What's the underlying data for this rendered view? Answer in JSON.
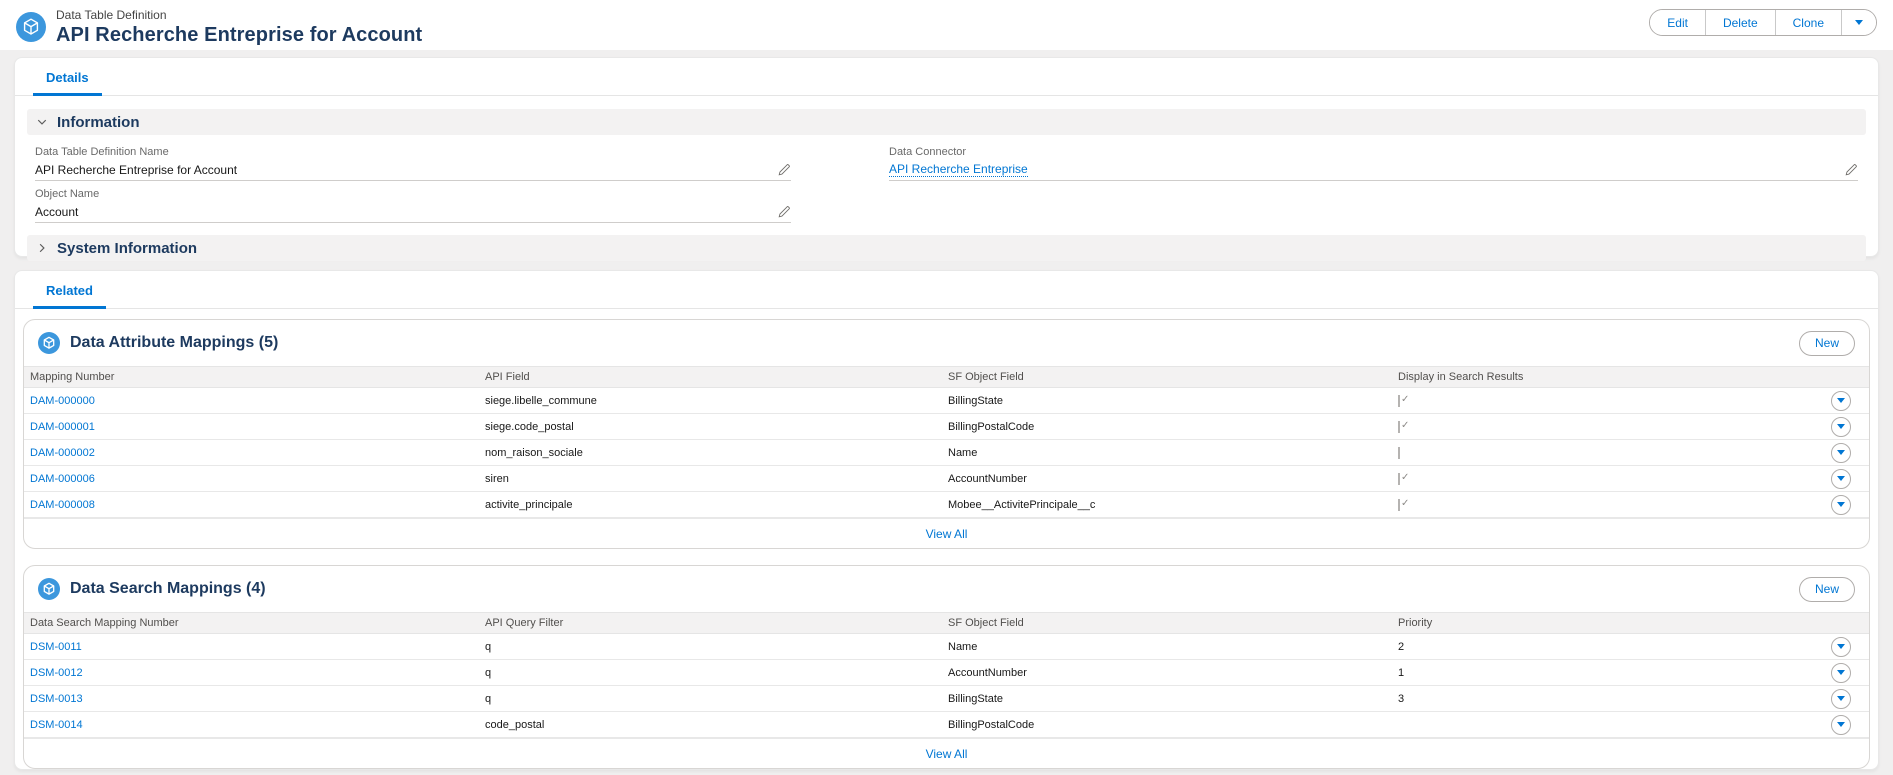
{
  "header": {
    "entity_label": "Data Table Definition",
    "title": "API Recherche Entreprise for Account",
    "actions": {
      "edit": "Edit",
      "delete": "Delete",
      "clone": "Clone"
    }
  },
  "details": {
    "tab_label": "Details",
    "information": {
      "title": "Information",
      "fields": {
        "data_table_definition_name": {
          "label": "Data Table Definition Name",
          "value": "API Recherche Entreprise for Account"
        },
        "data_connector": {
          "label": "Data Connector",
          "value": "API Recherche Entreprise"
        },
        "object_name": {
          "label": "Object Name",
          "value": "Account"
        }
      }
    },
    "system_information": {
      "title": "System Information"
    }
  },
  "related": {
    "tab_label": "Related",
    "attribute_mappings": {
      "title": "Data Attribute Mappings (5)",
      "new_label": "New",
      "view_all_label": "View All",
      "columns": [
        "Mapping Number",
        "API Field",
        "SF Object Field",
        "Display in Search Results"
      ],
      "rows": [
        {
          "number": "DAM-000000",
          "api_field": "siege.libelle_commune",
          "sf_field": "BillingState",
          "display": true
        },
        {
          "number": "DAM-000001",
          "api_field": "siege.code_postal",
          "sf_field": "BillingPostalCode",
          "display": true
        },
        {
          "number": "DAM-000002",
          "api_field": "nom_raison_sociale",
          "sf_field": "Name",
          "display": false
        },
        {
          "number": "DAM-000006",
          "api_field": "siren",
          "sf_field": "AccountNumber",
          "display": true
        },
        {
          "number": "DAM-000008",
          "api_field": "activite_principale",
          "sf_field": "Mobee__ActivitePrincipale__c",
          "display": true
        }
      ]
    },
    "search_mappings": {
      "title": "Data Search Mappings (4)",
      "new_label": "New",
      "view_all_label": "View All",
      "columns": [
        "Data Search Mapping Number",
        "API Query Filter",
        "SF Object Field",
        "Priority"
      ],
      "rows": [
        {
          "number": "DSM-0011",
          "query_filter": "q",
          "sf_field": "Name",
          "priority": "2"
        },
        {
          "number": "DSM-0012",
          "query_filter": "q",
          "sf_field": "AccountNumber",
          "priority": "1"
        },
        {
          "number": "DSM-0013",
          "query_filter": "q",
          "sf_field": "BillingState",
          "priority": "3"
        },
        {
          "number": "DSM-0014",
          "query_filter": "code_postal",
          "sf_field": "BillingPostalCode",
          "priority": ""
        }
      ]
    }
  },
  "colors": {
    "accent_blue": "#0176d3",
    "title_navy": "#1d3a5f",
    "icon_blue": "#3c97dd"
  }
}
